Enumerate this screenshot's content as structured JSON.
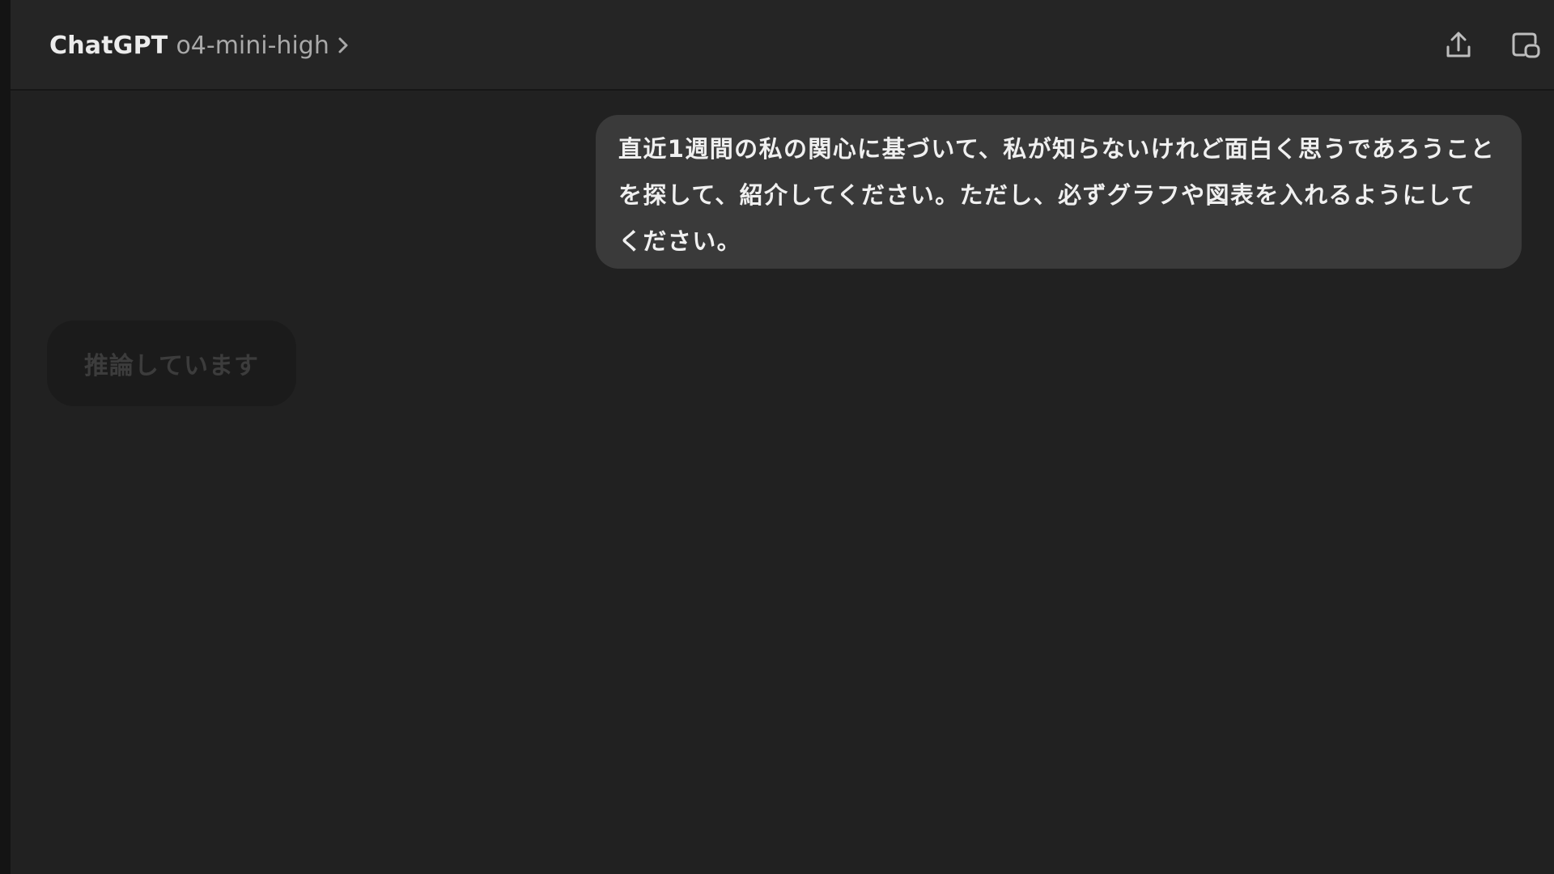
{
  "header": {
    "app_name": "ChatGPT",
    "model_name": "o4-mini-high",
    "icons": {
      "model_chevron": "chevron-right-icon",
      "share": "share-icon",
      "temporary_chat": "temporary-chat-icon"
    }
  },
  "conversation": {
    "user_message": "直近1週間の私の関心に基づいて、私が知らないけれど面白く思うであろうことを探して、紹介してください。ただし、必ずグラフや図表を入れるようにしてください。",
    "assistant_status": "推論しています"
  },
  "colors": {
    "background": "#212121",
    "header": "#252525",
    "user_bubble": "#3a3a3a",
    "status_pill": "#1b1b1b"
  }
}
